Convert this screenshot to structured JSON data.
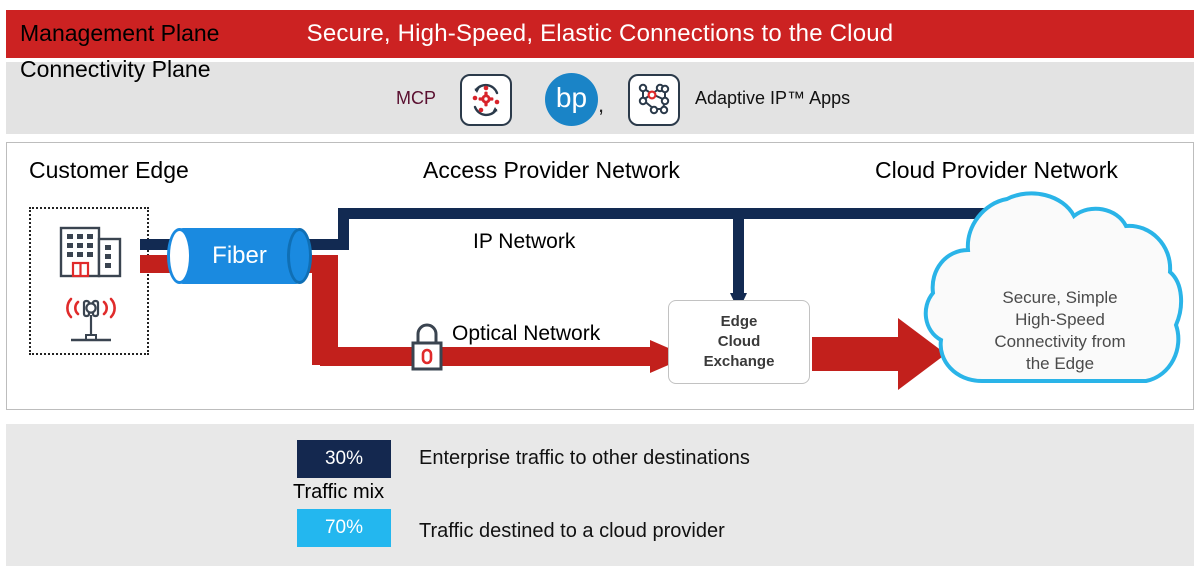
{
  "title_banner": {
    "text": "Secure, High-Speed, Elastic Connections to the Cloud",
    "background": "#cc2222",
    "text_color": "#ffffff"
  },
  "management_plane": {
    "label": "Management Plane",
    "mcp_label": "MCP",
    "mcp_icon": "gear-sync-icon",
    "bp_logo_text": "bp",
    "bp_logo_color": "#1a84c7",
    "separator": ",",
    "adaptive_icon": "network-nodes-icon",
    "adaptive_label": "Adaptive IP™ Apps",
    "background": "#e3e3e3"
  },
  "diagram": {
    "headings": {
      "customer_edge": "Customer Edge",
      "access_provider": "Access Provider Network",
      "cloud_provider": "Cloud Provider Network"
    },
    "customer_edge": {
      "building_icon": "office-building-icon",
      "tower_icon": "cell-tower-icon"
    },
    "fiber": {
      "label": "Fiber",
      "color": "#1a8ae0"
    },
    "links": {
      "ip_network": "IP Network",
      "optical_network": "Optical Network",
      "lock_icon": "padlock-icon",
      "ip_line_color": "#122a52",
      "optical_line_color": "#c2201c"
    },
    "edge_cloud_exchange": {
      "line1": "Edge",
      "line2": "Cloud",
      "line3": "Exchange"
    },
    "cloud": {
      "line1": "Secure, Simple",
      "line2": "High-Speed",
      "line3": "Connectivity from",
      "line4": "the Edge",
      "outline_color": "#2ab4e8",
      "fill_color": "#fafafa"
    }
  },
  "connectivity_plane": {
    "label": "Connectivity Plane",
    "traffic_mix_label": "Traffic mix",
    "background": "#e8e8e8",
    "segments": [
      {
        "percent": "30%",
        "color": "#14284f",
        "description": "Enterprise traffic to other destinations"
      },
      {
        "percent": "70%",
        "color": "#23b7ef",
        "description": "Traffic destined to a cloud provider"
      }
    ]
  }
}
